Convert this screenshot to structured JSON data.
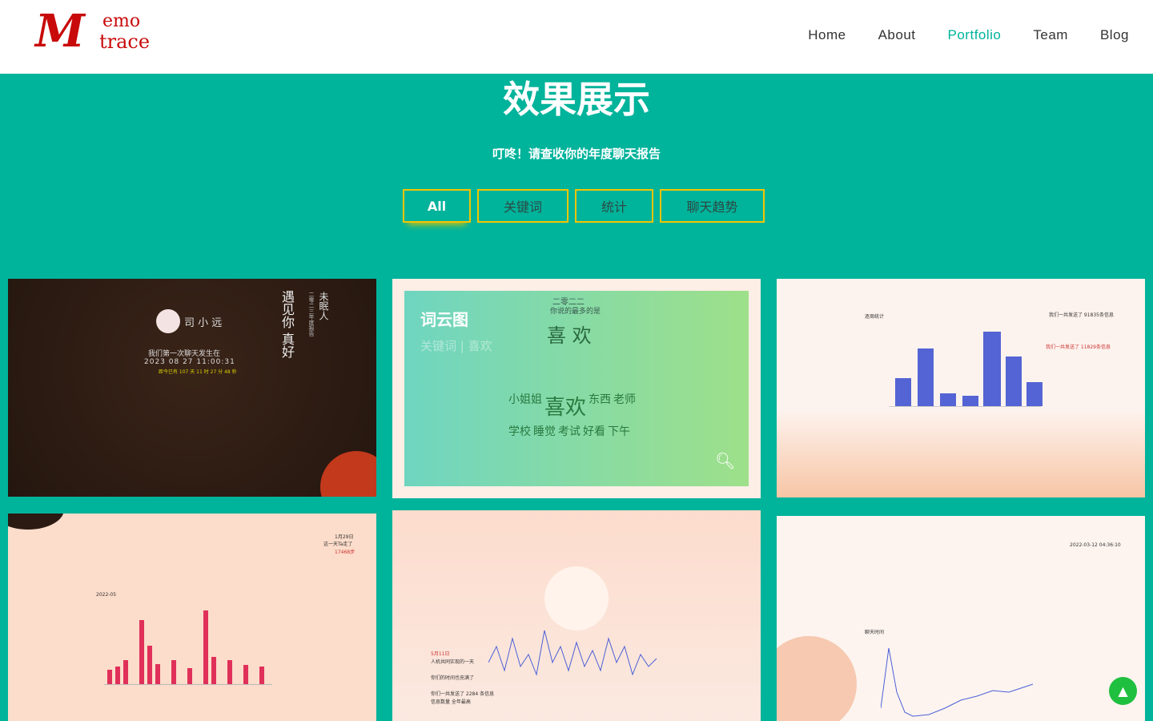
{
  "header": {
    "logo_text": "memo trace",
    "nav": [
      "Home",
      "About",
      "Portfolio",
      "Team",
      "Blog"
    ],
    "active": "Portfolio"
  },
  "hero": {
    "title": "效果展示",
    "subtitle": "叮咚！请查收你的年度聊天报告"
  },
  "filters": [
    "All",
    "关键词",
    "统计",
    "聊天趋势"
  ],
  "active_filter": "All",
  "portfolio": {
    "card1": {
      "name": "司 小 远",
      "line1": "我们第一次聊天发生在",
      "datetime": "2023 08 27 11:00:31",
      "since": "距今已有 107 天 11 时 27 分 48 秒",
      "poem": "遇见你 真好",
      "side": "二零二三年度报告",
      "side2": "未眠人"
    },
    "card2": {
      "overlay_title": "词云图",
      "overlay_sub": "关键词 | 喜欢",
      "year": "二零二二",
      "said_most": "你说的最多的是",
      "top_word": "喜 欢",
      "words": [
        "小姐姐",
        "喜欢",
        "东西",
        "老师",
        "学校",
        "睡觉",
        "考试",
        "好看",
        "下午"
      ]
    },
    "card3": {
      "chart_title": "逐周统计",
      "lines": [
        "我们一共发送了 91835条信息",
        "我们一共发送了 11829条信息"
      ]
    },
    "card4": {
      "date": "2022-05",
      "note": [
        "1月29日",
        "这一天Ta走了",
        "17468步"
      ]
    },
    "card5": {
      "notes": [
        "5月11日",
        "人机共同实现的一天",
        "你们的时间也充满了",
        "你们一共发送了 2284 条信息",
        "信息数量 全年最高"
      ]
    },
    "card6": {
      "time": "2022-03-12 04:36:10",
      "chart_title": "聊天时间"
    }
  },
  "colors": {
    "teal": "#00b39b",
    "filter_border": "#f5c400",
    "logo_red": "#c80a0a",
    "to_top": "#1fbf3f"
  },
  "icons": {
    "search": "search-icon",
    "to_top": "arrow-up-icon"
  }
}
